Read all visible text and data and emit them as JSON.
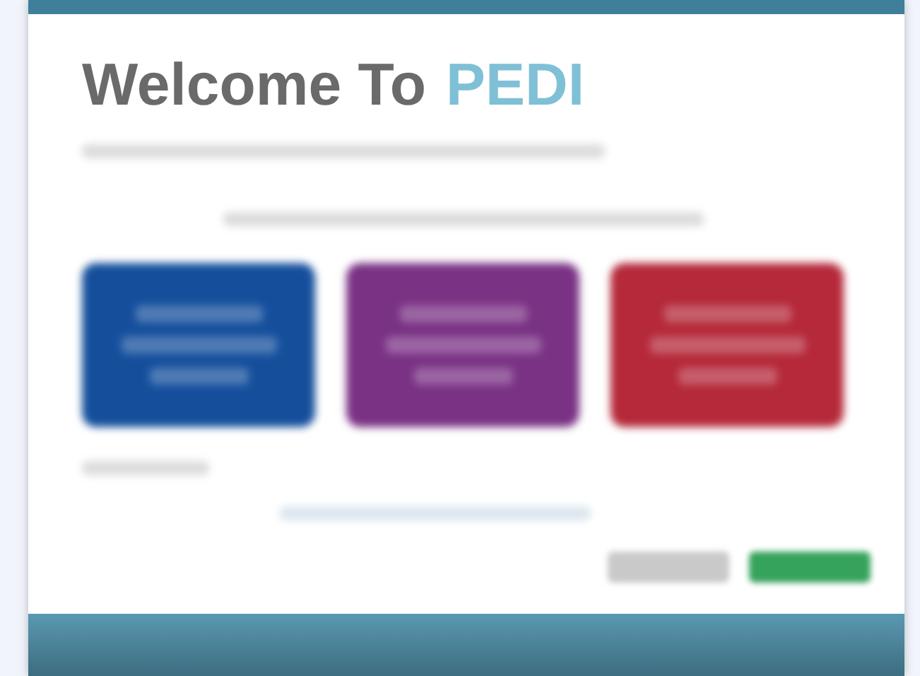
{
  "heading": {
    "text": "Welcome To",
    "highlight": "PEDI"
  },
  "cards": [
    {
      "color": "#154f9c"
    },
    {
      "color": "#7a3284"
    },
    {
      "color": "#b5293a"
    }
  ],
  "footer_buttons": [
    {
      "kind": "secondary"
    },
    {
      "kind": "primary"
    }
  ]
}
